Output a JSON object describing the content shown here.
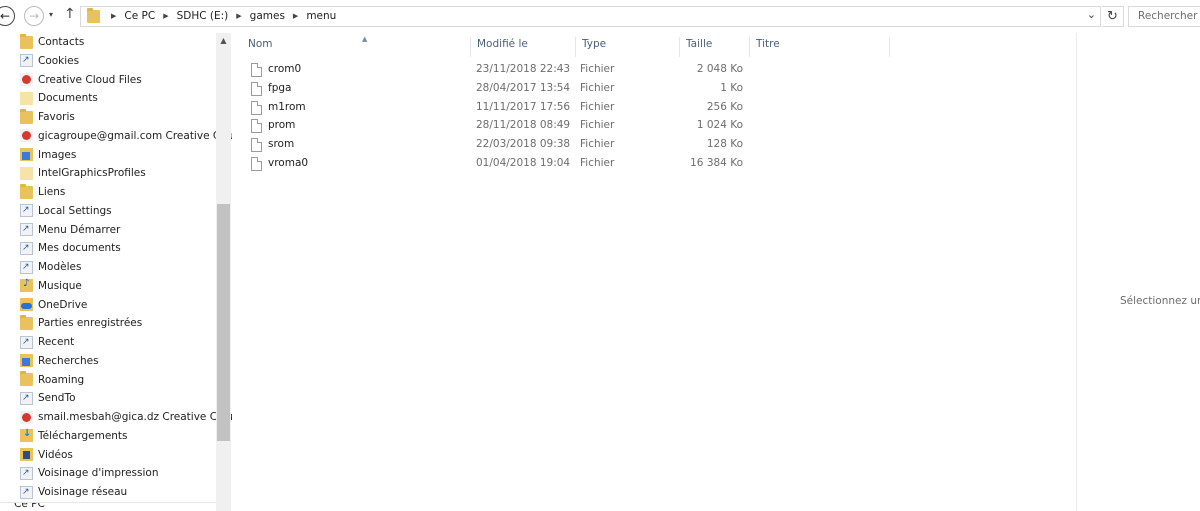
{
  "address": {
    "crumbs": [
      "Ce PC",
      "SDHC (E:)",
      "games",
      "menu"
    ],
    "search_placeholder": "Rechercher dans : menu"
  },
  "sidebar": {
    "items": [
      {
        "label": "Contacts",
        "icon": "contacts-folder-icon",
        "kind": "folder"
      },
      {
        "label": "Cookies",
        "icon": "shortcut-icon",
        "kind": "shortcut"
      },
      {
        "label": "Creative Cloud Files",
        "icon": "creative-cloud-icon",
        "kind": "cc"
      },
      {
        "label": "Documents",
        "icon": "documents-folder-icon",
        "kind": "pale"
      },
      {
        "label": "Favoris",
        "icon": "favorites-folder-icon",
        "kind": "folder"
      },
      {
        "label": "gicagroupe@gmail.com Creative Cloud",
        "icon": "creative-cloud-icon",
        "kind": "cc"
      },
      {
        "label": "Images",
        "icon": "images-folder-icon",
        "kind": "blue"
      },
      {
        "label": "IntelGraphicsProfiles",
        "icon": "folder-icon",
        "kind": "pale"
      },
      {
        "label": "Liens",
        "icon": "links-folder-icon",
        "kind": "folder"
      },
      {
        "label": "Local Settings",
        "icon": "shortcut-icon",
        "kind": "shortcut"
      },
      {
        "label": "Menu Démarrer",
        "icon": "shortcut-icon",
        "kind": "shortcut"
      },
      {
        "label": "Mes documents",
        "icon": "shortcut-icon",
        "kind": "shortcut"
      },
      {
        "label": "Modèles",
        "icon": "shortcut-icon",
        "kind": "shortcut"
      },
      {
        "label": "Musique",
        "icon": "music-folder-icon",
        "kind": "music"
      },
      {
        "label": "OneDrive",
        "icon": "onedrive-icon",
        "kind": "onedrive"
      },
      {
        "label": "Parties enregistrées",
        "icon": "saved-games-folder-icon",
        "kind": "folder"
      },
      {
        "label": "Recent",
        "icon": "shortcut-icon",
        "kind": "shortcut"
      },
      {
        "label": "Recherches",
        "icon": "searches-folder-icon",
        "kind": "blue"
      },
      {
        "label": "Roaming",
        "icon": "folder-icon",
        "kind": "folder"
      },
      {
        "label": "SendTo",
        "icon": "shortcut-icon",
        "kind": "shortcut"
      },
      {
        "label": "smail.mesbah@gica.dz Creative Cloud",
        "icon": "creative-cloud-icon",
        "kind": "cc"
      },
      {
        "label": "Téléchargements",
        "icon": "downloads-folder-icon",
        "kind": "down"
      },
      {
        "label": "Vidéos",
        "icon": "videos-folder-icon",
        "kind": "video"
      },
      {
        "label": "Voisinage d'impression",
        "icon": "shortcut-icon",
        "kind": "shortcut"
      },
      {
        "label": "Voisinage réseau",
        "icon": "shortcut-icon",
        "kind": "shortcut"
      }
    ],
    "bottom_item": "Ce PC"
  },
  "columns": {
    "name": "Nom",
    "modified": "Modifié le",
    "type": "Type",
    "size": "Taille",
    "title": "Titre"
  },
  "files": [
    {
      "name": "crom0",
      "modified": "23/11/2018 22:43",
      "type": "Fichier",
      "size": "2 048 Ko"
    },
    {
      "name": "fpga",
      "modified": "28/04/2017 13:54",
      "type": "Fichier",
      "size": "1 Ko"
    },
    {
      "name": "m1rom",
      "modified": "11/11/2017 17:56",
      "type": "Fichier",
      "size": "256 Ko"
    },
    {
      "name": "prom",
      "modified": "28/11/2018 08:49",
      "type": "Fichier",
      "size": "1 024 Ko"
    },
    {
      "name": "srom",
      "modified": "22/03/2018 09:38",
      "type": "Fichier",
      "size": "128 Ko"
    },
    {
      "name": "vroma0",
      "modified": "01/04/2018 19:04",
      "type": "Fichier",
      "size": "16 384 Ko"
    }
  ],
  "preview": {
    "message": "Sélectionnez un f"
  }
}
